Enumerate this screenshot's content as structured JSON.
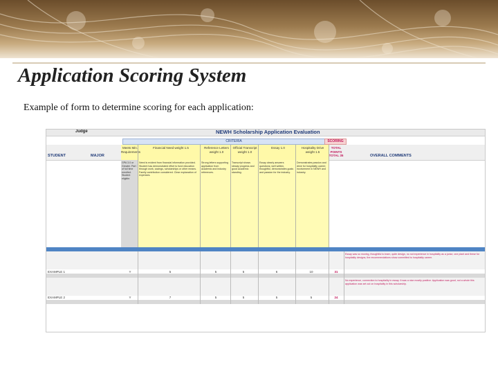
{
  "slide": {
    "title": "Application Scoring System",
    "subtitle": "Example of form to determine scoring for each application:"
  },
  "spreadsheet": {
    "judge_label": "Judge",
    "title": "NEWH Scholarship Application Evaluation",
    "criteria_label": "CRITERIA",
    "scoring_label": "SCORING",
    "student_header": "STUDENT",
    "major_header": "MAJOR",
    "criteria_headers": [
      "Meets Min. Requirements",
      "Financial Need weight 1.5",
      "Reference Letters weight 1.0",
      "Official Transcript weight 1.0",
      "Essay 1.0",
      "Hospitality Drive weight 1.5"
    ],
    "total_header": "TOTAL POINTS TOTAL 35",
    "overall_header": "OVERALL COMMENTS",
    "descriptions": [
      "GPA 3.0 or Greater. Part of full time enrolled. Student eligible.",
      "Need is evident from financial information provided. Student has demonstrated effort to fund education through work, savings, scholarships or other means. Family contribution considered. Clear explanation of expenses.",
      "Strong letters supporting application from academic and industry references.",
      "Transcript shows steady progress and good academic standing.",
      "Essay clearly answers questions; well written, thoughtful, demonstrates goals and passion for the industry.",
      "Demonstrates passion and drive for hospitality career; involvement in NEWH and industry."
    ],
    "rows": [
      {
        "name": "EXAMPLE 1",
        "scores": [
          "Y",
          "5",
          "5",
          "5",
          "6",
          "10",
          "31"
        ],
        "comment": "Essay was so moving, thoughtful to learn, quite design, no not experience in hospitality as a junior, one plant and these for hospitality designs, the recommendations show committed to hospitality career."
      },
      {
        "name": "EXAMPLE 2",
        "scores": [
          "Y",
          "7",
          "5",
          "5",
          "5",
          "5",
          "24"
        ],
        "comment": "No experience, connection to hospitality in essay. It was a nice mostly positive. Application was good, not a whole this application was set out on hospitality in this scholarship."
      }
    ]
  }
}
